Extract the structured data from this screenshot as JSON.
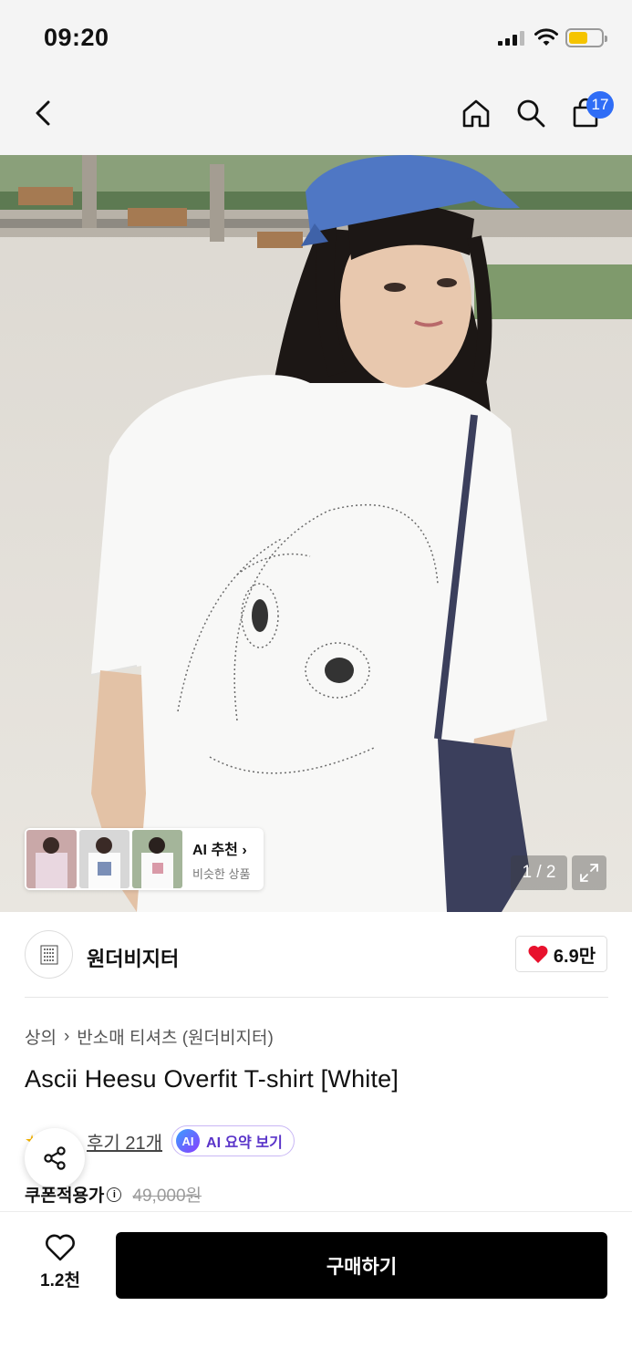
{
  "status_bar": {
    "time": "09:20",
    "battery_color": "#f5c400"
  },
  "nav": {
    "cart_count": "17",
    "icons": [
      "back-chevron-icon",
      "home-icon",
      "search-icon",
      "shopping-bag-icon"
    ],
    "badge_color": "#2f6df6"
  },
  "hero": {
    "pager": "1 / 2",
    "ai_recommend": {
      "title": "AI 추천",
      "subtitle": "비슷한 상품"
    }
  },
  "brand": {
    "name": "원더비지터",
    "likes": "6.9만"
  },
  "product": {
    "breadcrumb": [
      "상의",
      "반소매 티셔츠 (원더비지터)"
    ],
    "title": "Ascii Heesu Overfit T-shirt [White]",
    "review_link": "후기 21개",
    "ai_summary": "AI 요약 보기",
    "ai_badge": "AI",
    "price_label": "쿠폰적용가",
    "original_price": "49,000원"
  },
  "bottom": {
    "wish_count": "1.2천",
    "buy_label": "구매하기",
    "accent": "#000000"
  }
}
